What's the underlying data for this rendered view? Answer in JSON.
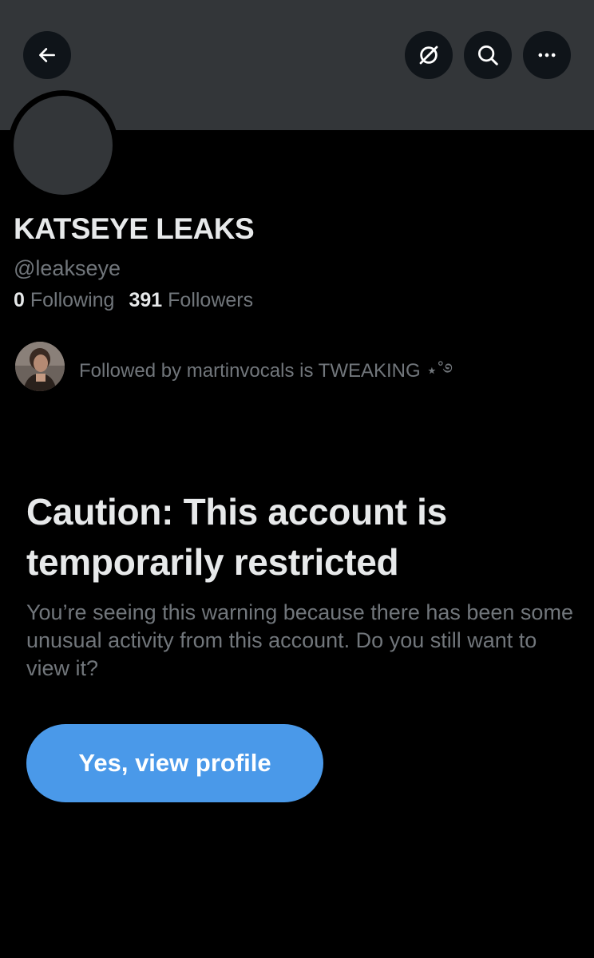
{
  "header": {
    "back_icon": "arrow-left-icon",
    "grok_icon": "grok-icon",
    "search_icon": "search-icon",
    "more_icon": "more-horizontal-icon"
  },
  "profile": {
    "display_name": "KATSEYE LEAKS",
    "handle": "@leakseye",
    "following_count": "0",
    "following_label": "Following",
    "followers_count": "391",
    "followers_label": "Followers",
    "followed_by_text": "Followed by martinvocals is TWEAKING ⋆˚࿔"
  },
  "warning": {
    "title": "Caution: This account is temporarily restricted",
    "body": "You’re seeing this warning because there has been some unusual activity from this account. Do you still want to view it?",
    "button_label": "Yes, view profile"
  },
  "colors": {
    "background": "#000000",
    "banner": "#333639",
    "primary_text": "#e7e9ea",
    "secondary_text": "#71767b",
    "accent_button": "#4a99e9"
  }
}
